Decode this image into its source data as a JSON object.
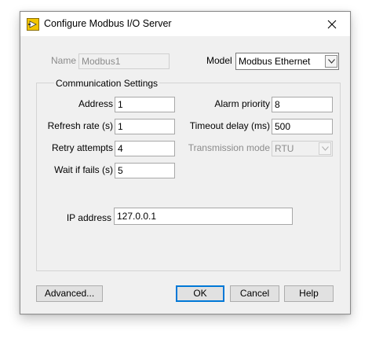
{
  "window": {
    "title": "Configure Modbus I/O Server",
    "close_glyph": "✕",
    "app_icon": "labview-icon",
    "app_icon_color": "#f2c500"
  },
  "general": {
    "name_label": "Name",
    "name_value": "Modbus1",
    "model_label": "Model",
    "model_value": "Modbus Ethernet"
  },
  "communication": {
    "title": "Communication Settings",
    "address_label": "Address",
    "address_value": "1",
    "refresh_label": "Refresh rate (s)",
    "refresh_value": "1",
    "retry_label": "Retry attempts",
    "retry_value": "4",
    "wait_label": "Wait if fails (s)",
    "wait_value": "5",
    "alarm_label": "Alarm priority",
    "alarm_value": "8",
    "timeout_label": "Timeout delay (ms)",
    "timeout_value": "500",
    "transmission_label": "Transmission mode",
    "transmission_value": "RTU",
    "ip_label": "IP address",
    "ip_value": "127.0.0.1"
  },
  "buttons": {
    "advanced": "Advanced...",
    "ok": "OK",
    "cancel": "Cancel",
    "help": "Help"
  },
  "colors": {
    "accent": "#0078d7",
    "dialog_bg": "#f0f0f0",
    "disabled_text": "#8c8c8c"
  }
}
